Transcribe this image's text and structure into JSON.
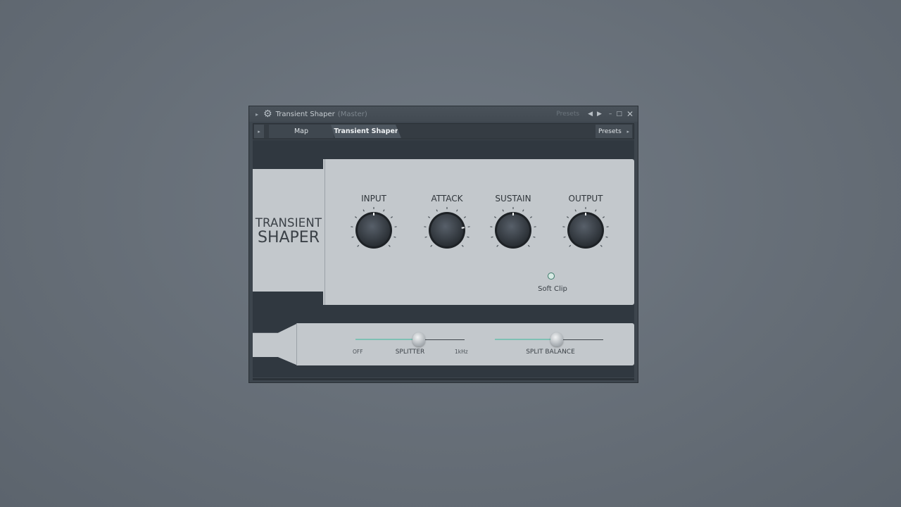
{
  "window": {
    "title": "Transient Shaper",
    "subtitle": "(Master)",
    "presets_label": "Presets",
    "prev_glyph": "◀",
    "next_glyph": "▶",
    "minimize_glyph": "–",
    "maximize_glyph": "□",
    "close_glyph": "✕"
  },
  "tabs": {
    "arrow_glyph": "▸",
    "items": [
      {
        "label": "Map"
      },
      {
        "label": "Transient Shaper"
      }
    ],
    "presets_label": "Presets",
    "presets_arrow": "▸"
  },
  "plugin": {
    "brand_line1": "TRANSIENT",
    "brand_line2": "SHAPER",
    "knobs": [
      {
        "label": "INPUT",
        "value": 0.5,
        "marker": false
      },
      {
        "label": "ATTACK",
        "value": 0.8,
        "marker": true
      },
      {
        "label": "SUSTAIN",
        "value": 0.5,
        "marker": true
      },
      {
        "label": "OUTPUT",
        "value": 0.5,
        "marker": false
      }
    ],
    "soft_clip": {
      "label": "Soft Clip",
      "on": false
    },
    "splitter": {
      "label": "SPLITTER",
      "min_label": "OFF",
      "max_label": "1kHz",
      "value": 0.58
    },
    "split_balance": {
      "label": "SPLIT BALANCE",
      "value": 0.57
    }
  },
  "icons": {
    "gear": "⚙",
    "collapse_arrow": "▸"
  },
  "colors": {
    "panel": "#c3c8cc",
    "accent": "#7fc0b4",
    "knob": "#3a4147"
  }
}
